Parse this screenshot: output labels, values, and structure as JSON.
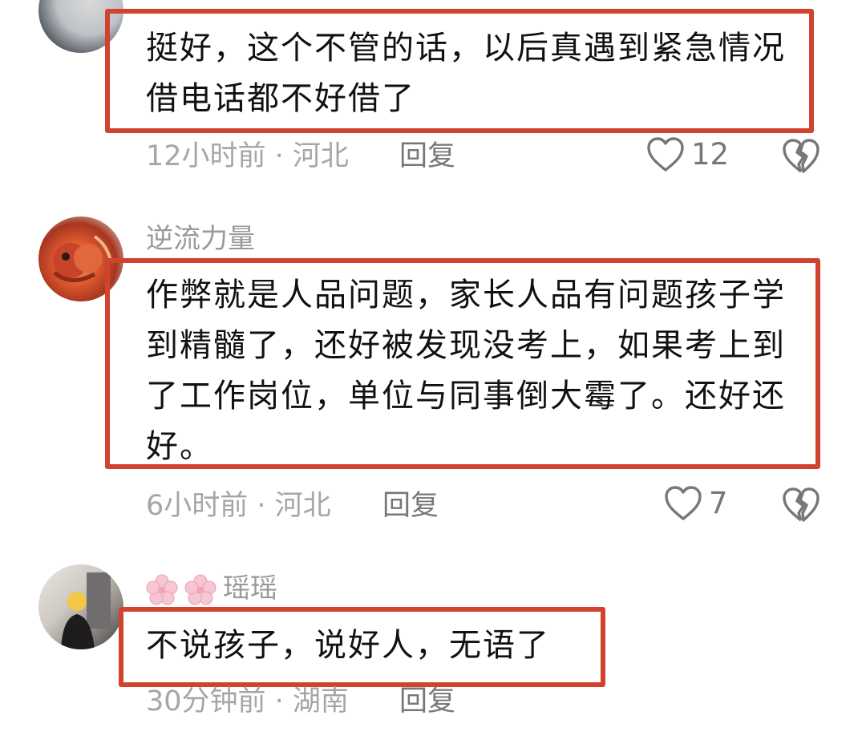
{
  "comments": [
    {
      "text": "挺好，这个不管的话，以后真遇到紧急情况借电话都不好借了",
      "time_location": "12小时前 · 河北",
      "reply_label": "回复",
      "likes": "12"
    },
    {
      "username": "逆流力量",
      "text": "作弊就是人品问题，家长人品有问题孩子学到精髓了，还好被发现没考上，如果考上到了工作岗位，单位与同事倒大霉了。还好还好。",
      "time_location": "6小时前 · 河北",
      "reply_label": "回复",
      "likes": "7"
    },
    {
      "username": "瑶瑶",
      "text": "不说孩子，说好人，无语了",
      "time_location": "30分钟前 · 湖南",
      "reply_label": "回复"
    }
  ],
  "icons": {
    "like": "heart-outline-icon",
    "dislike": "broken-heart-icon",
    "username_prefix": "cherry-blossom-emoji"
  },
  "colors": {
    "highlight_border": "#d2432f",
    "meta_text": "#a6a6a6"
  }
}
